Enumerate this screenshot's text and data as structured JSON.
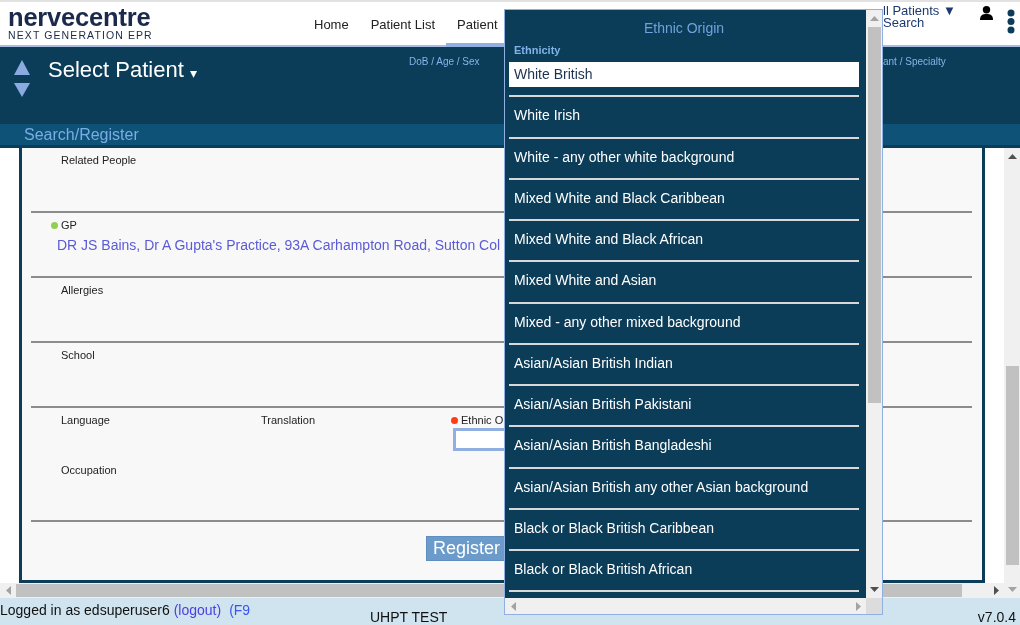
{
  "header": {
    "logo": {
      "wordmark": "nervecentre",
      "tagline": "NEXT GENERATION EPR"
    },
    "nav": [
      {
        "label": "Home",
        "selected": false
      },
      {
        "label": "Patient List",
        "selected": false
      },
      {
        "label": "Patient",
        "selected": true
      }
    ],
    "ward_menu": "ll Patients ▼",
    "search_link": "Search"
  },
  "banner": {
    "title": "Select Patient",
    "title_caret": "▾",
    "columns": [
      "DoB / Age / Sex",
      "ant / Specialty"
    ]
  },
  "subheader": "Search/Register",
  "form": {
    "rows": [
      {
        "fields": [
          {
            "kind": "label",
            "label": "Related People"
          }
        ]
      },
      {
        "fields": [
          {
            "kind": "value",
            "label": "GP",
            "color": "#8fd14f",
            "value": "DR JS Bains, Dr A Gupta's Practice, 93A Carhampton Road, Sutton Col"
          }
        ]
      },
      {
        "fields": [
          {
            "kind": "label",
            "label": "Allergies"
          }
        ]
      },
      {
        "fields": [
          {
            "kind": "label",
            "label": "School"
          }
        ]
      },
      {
        "fields": [
          {
            "kind": "label",
            "label": "Language"
          },
          {
            "kind": "label",
            "label": "Translation"
          },
          {
            "kind": "input",
            "label": "Ethnic O",
            "color": "#ff3c14"
          },
          {
            "kind": "label",
            "label": "Occupation"
          }
        ]
      }
    ],
    "button": "Register"
  },
  "dropdown": {
    "title": "Ethnic Origin",
    "field_label": "Ethnicity",
    "options": [
      {
        "label": "White British",
        "selected": true
      },
      {
        "label": "White Irish",
        "selected": false
      },
      {
        "label": "White - any other white background",
        "selected": false
      },
      {
        "label": "Mixed White and Black Caribbean",
        "selected": false
      },
      {
        "label": "Mixed White and Black African",
        "selected": false
      },
      {
        "label": "Mixed White and Asian",
        "selected": false
      },
      {
        "label": "Mixed - any other mixed background",
        "selected": false
      },
      {
        "label": "Asian/Asian British Indian",
        "selected": false
      },
      {
        "label": "Asian/Asian British Pakistani",
        "selected": false
      },
      {
        "label": "Asian/Asian British Bangladeshi",
        "selected": false
      },
      {
        "label": "Asian/Asian British any other Asian background",
        "selected": false
      },
      {
        "label": "Black or Black British Caribbean",
        "selected": false
      },
      {
        "label": "Black or Black British African",
        "selected": false
      }
    ]
  },
  "footer": {
    "user_text": "Logged in as edsuperuser6",
    "logout_link": "(logout)",
    "lock_link": "(F9",
    "environment": "UHPT TEST",
    "version": "v7.0.4"
  }
}
